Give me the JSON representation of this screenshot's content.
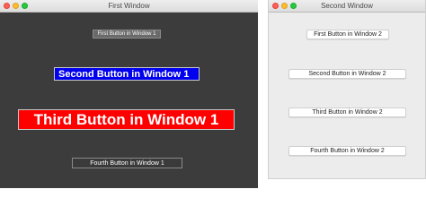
{
  "windows": [
    {
      "title": "First Window",
      "buttons": [
        {
          "label": "First Button in Window 1"
        },
        {
          "label": "Second Button in Window 1"
        },
        {
          "label": "Third Button in Window 1"
        },
        {
          "label": "Fourth Button in Window 1"
        }
      ]
    },
    {
      "title": "Second Window",
      "buttons": [
        {
          "label": "First Button in Window 2"
        },
        {
          "label": "Second Button in Window 2"
        },
        {
          "label": "Third Button in Window 2"
        },
        {
          "label": "Fourth Button in Window 2"
        }
      ]
    }
  ],
  "colors": {
    "window1_background": "#3c3c3c",
    "window2_background": "#ececec",
    "second_button_window1": "#0000ee",
    "third_button_window1": "#ff0000"
  },
  "icons": [
    "close-icon",
    "minimize-icon",
    "zoom-icon"
  ]
}
